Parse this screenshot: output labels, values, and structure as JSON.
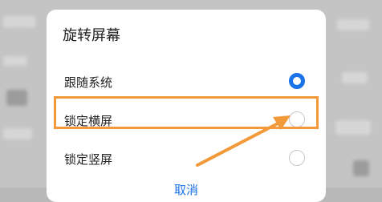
{
  "dialog": {
    "title": "旋转屏幕",
    "options": [
      {
        "label": "跟随系统",
        "selected": true
      },
      {
        "label": "锁定横屏",
        "selected": false
      },
      {
        "label": "锁定竖屏",
        "selected": false
      }
    ],
    "cancel_label": "取消"
  },
  "colors": {
    "accent": "#1a73e8",
    "annotation": "#f29a3a"
  }
}
